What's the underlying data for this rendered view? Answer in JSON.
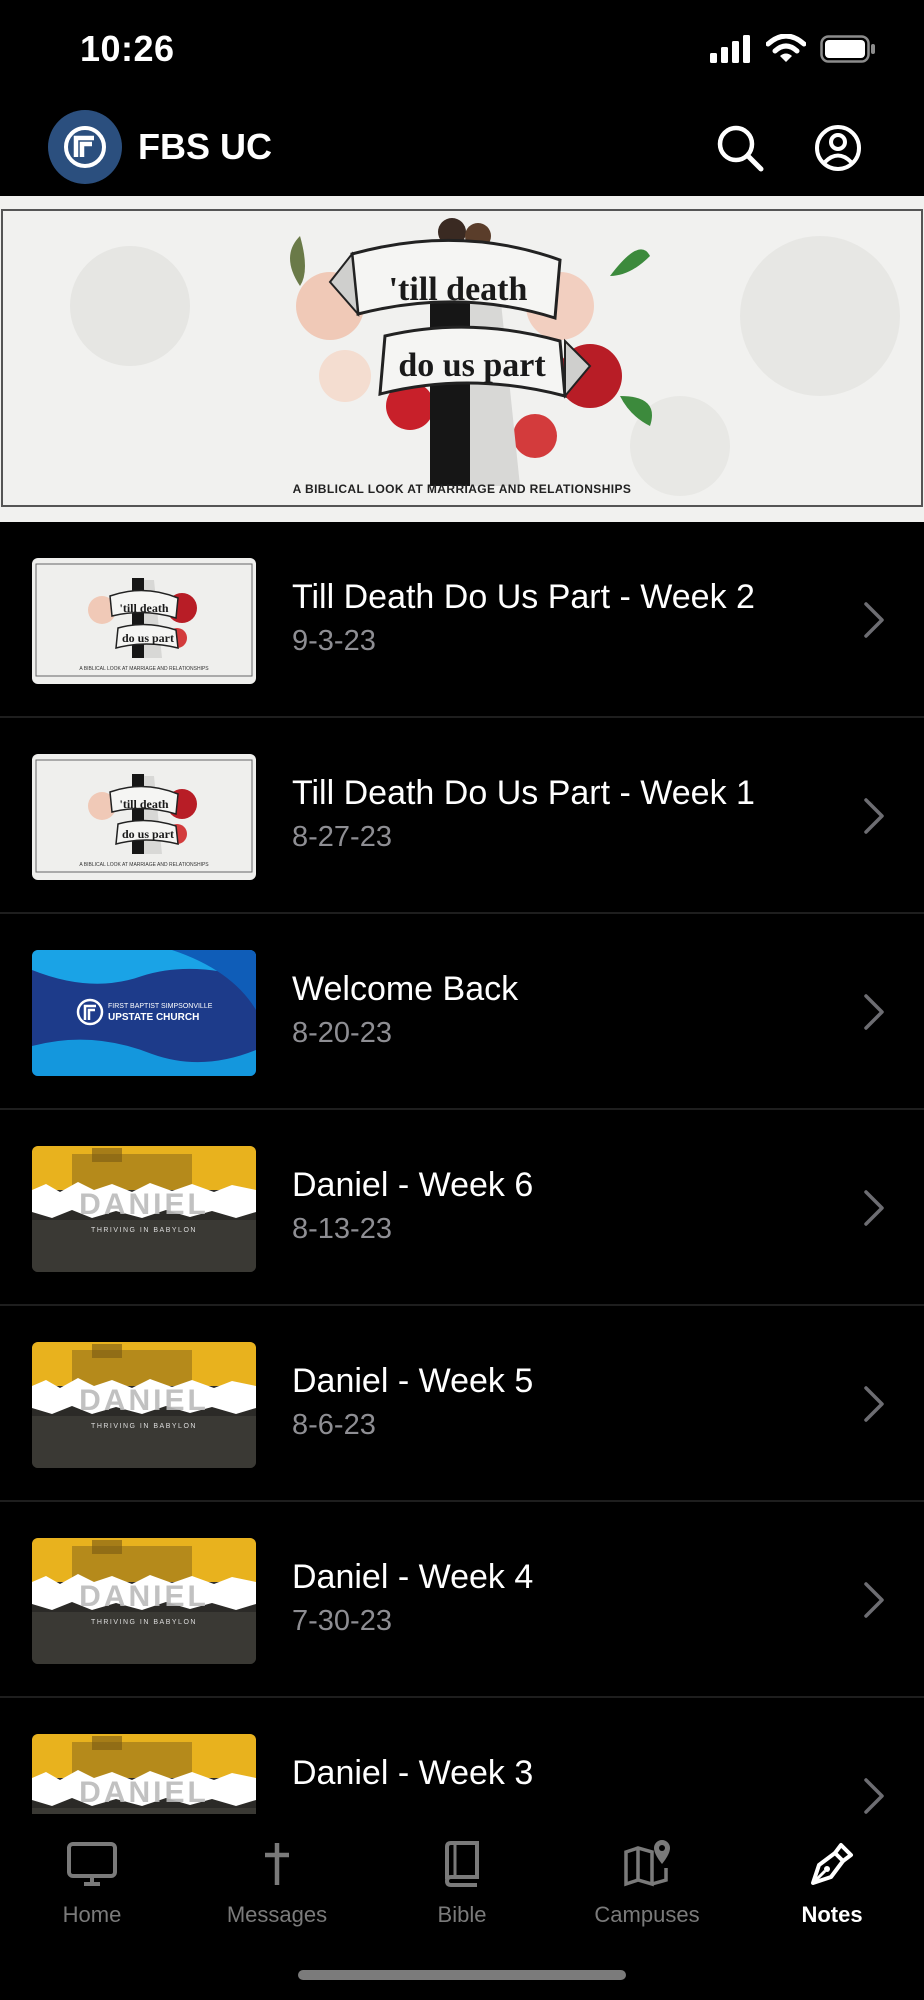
{
  "status_bar": {
    "time": "10:26"
  },
  "header": {
    "title": "FBS UC",
    "icons": [
      "logo-icon",
      "search-icon",
      "profile-icon"
    ]
  },
  "hero": {
    "title_line1": "'till death",
    "title_line2": "do us part",
    "subtitle": "A BIBLICAL LOOK AT MARRIAGE AND RELATIONSHIPS"
  },
  "messages": [
    {
      "title": "Till Death Do Us Part - Week 2",
      "date": "9-3-23",
      "thumb": "till-death"
    },
    {
      "title": "Till Death Do Us Part - Week 1",
      "date": "8-27-23",
      "thumb": "till-death"
    },
    {
      "title": "Welcome Back",
      "date": "8-20-23",
      "thumb": "welcome"
    },
    {
      "title": "Daniel - Week 6",
      "date": "8-13-23",
      "thumb": "daniel"
    },
    {
      "title": "Daniel - Week 5",
      "date": "8-6-23",
      "thumb": "daniel"
    },
    {
      "title": "Daniel - Week 4",
      "date": "7-30-23",
      "thumb": "daniel"
    },
    {
      "title": "Daniel - Week 3",
      "date": "",
      "thumb": "daniel"
    }
  ],
  "thumbs": {
    "till_death_line1": "'till death",
    "till_death_line2": "do us part",
    "till_death_caption": "A BIBLICAL LOOK AT MARRIAGE AND RELATIONSHIPS",
    "welcome_line1": "FIRST BAPTIST SIMPSONVILLE",
    "welcome_line2": "UPSTATE CHURCH",
    "daniel_title": "DANIEL",
    "daniel_subtitle": "THRIVING IN BABYLON"
  },
  "tabs": [
    {
      "label": "Home",
      "icon": "tv-icon",
      "active": false
    },
    {
      "label": "Messages",
      "icon": "cross-icon",
      "active": false
    },
    {
      "label": "Bible",
      "icon": "book-icon",
      "active": false
    },
    {
      "label": "Campuses",
      "icon": "map-icon",
      "active": false
    },
    {
      "label": "Notes",
      "icon": "pen-icon",
      "active": true
    }
  ],
  "colors": {
    "background": "#000000",
    "logo": "#2b4f7e",
    "secondary_text": "#8e8e93",
    "divider": "#1e1e1e",
    "daniel_gold": "#e8b21e",
    "welcome_blue": "#1d3b8a"
  }
}
